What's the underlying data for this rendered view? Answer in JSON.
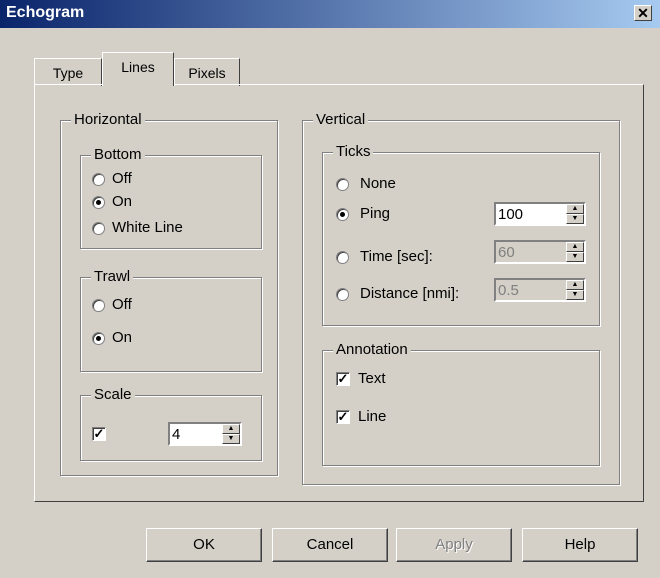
{
  "window": {
    "title": "Echogram",
    "close_glyph": "✕"
  },
  "tabs": [
    {
      "label": "Type",
      "active": false
    },
    {
      "label": "Lines",
      "active": true
    },
    {
      "label": "Pixels",
      "active": false
    }
  ],
  "horizontal": {
    "label": "Horizontal",
    "bottom": {
      "label": "Bottom",
      "options": [
        "Off",
        "On",
        "White Line"
      ],
      "selected": "On"
    },
    "trawl": {
      "label": "Trawl",
      "options": [
        "Off",
        "On"
      ],
      "selected": "On"
    },
    "scale": {
      "label": "Scale",
      "checked": true,
      "value": "4"
    }
  },
  "vertical": {
    "label": "Vertical",
    "ticks": {
      "label": "Ticks",
      "none": "None",
      "ping": {
        "label": "Ping",
        "value": "100"
      },
      "time": {
        "label": "Time [sec]:",
        "value": "60"
      },
      "distance": {
        "label": "Distance [nmi]:",
        "value": "0.5"
      },
      "selected": "Ping"
    },
    "annotation": {
      "label": "Annotation",
      "text": {
        "label": "Text",
        "checked": true
      },
      "line": {
        "label": "Line",
        "checked": true
      }
    }
  },
  "buttons": {
    "ok": "OK",
    "cancel": "Cancel",
    "apply": "Apply",
    "help": "Help"
  },
  "glyphs": {
    "check": "✓",
    "up": "▲",
    "down": "▼"
  }
}
